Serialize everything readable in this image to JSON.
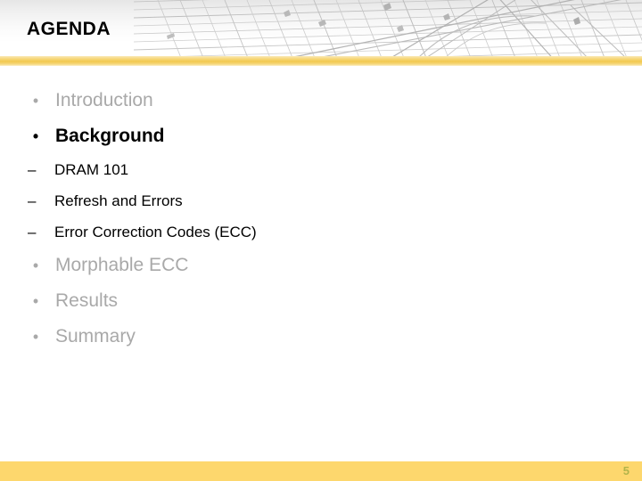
{
  "slide": {
    "title": "AGENDA",
    "page_number": "5",
    "accent_gold": "#f2c94f",
    "footer_gold": "#fdd76d",
    "dim_text_color": "#a9a9a9",
    "active_text_color": "#000000",
    "page_number_color": "#b2b44a"
  },
  "header": {
    "art_name": "architectural-grid-artwork"
  },
  "agenda": {
    "items": [
      {
        "label": "Introduction",
        "state": "dim",
        "bullet_glyph": "•",
        "sub_items": []
      },
      {
        "label": "Background",
        "state": "active",
        "bullet_glyph": "•",
        "sub_items": [
          {
            "label": "DRAM 101",
            "dash_glyph": "–"
          },
          {
            "label": "Refresh and Errors",
            "dash_glyph": "–"
          },
          {
            "label": "Error Correction Codes (ECC)",
            "dash_glyph": "–"
          }
        ]
      },
      {
        "label": "Morphable ECC",
        "state": "dim",
        "bullet_glyph": "•",
        "sub_items": []
      },
      {
        "label": "Results",
        "state": "dim",
        "bullet_glyph": "•",
        "sub_items": []
      },
      {
        "label": "Summary",
        "state": "dim",
        "bullet_glyph": "•",
        "sub_items": []
      }
    ]
  }
}
